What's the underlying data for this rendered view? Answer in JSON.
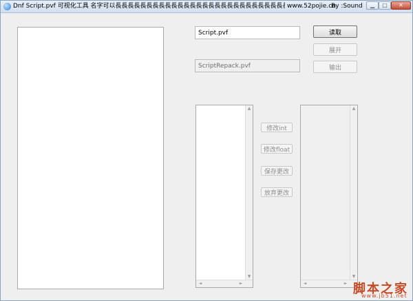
{
  "titlebar": {
    "title": "Dnf Script.pvf 可视化工具 名字可以長長長長長長長長長長長長長長長長長長長長長長長長長長長長長長長長一點",
    "url": "www.52pojie.cn",
    "author": "By :Sound",
    "min_glyph": "▁",
    "max_glyph": "□",
    "close_glyph": "✕"
  },
  "inputs": {
    "source_file": "Script.pvf",
    "output_file": "ScriptRepack.pvf"
  },
  "buttons": {
    "read": "读取",
    "expand": "展开",
    "export": "输出",
    "modify_int": "修改int",
    "modify_float": "修改float",
    "save_changes": "保存更改",
    "discard_changes": "放弃更改"
  },
  "scroll": {
    "up": "▲",
    "down": "▼",
    "left": "◄",
    "right": "►"
  },
  "watermark": {
    "logo": "脚本之家",
    "site": "www.jb51.net"
  },
  "colors": {
    "window_bg": "#efefef",
    "titlebar": "#d2dfee",
    "close_button": "#c44d36",
    "watermark": "#c74a24"
  }
}
